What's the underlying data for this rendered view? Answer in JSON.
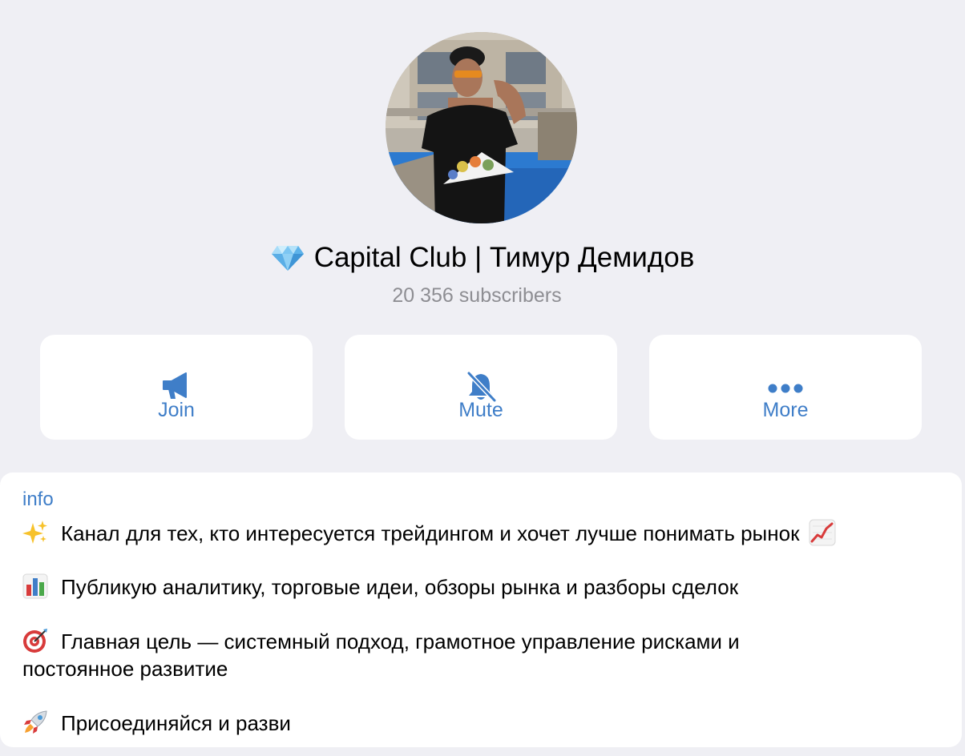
{
  "channel": {
    "title": "Capital Club | Тимур Демидов",
    "subscribers": "20 356 subscribers",
    "title_icon": "gem-icon"
  },
  "actions": [
    {
      "label": "Join",
      "icon": "megaphone-icon"
    },
    {
      "label": "Mute",
      "icon": "bell-slash-icon"
    },
    {
      "label": "More",
      "icon": "ellipsis-icon"
    }
  ],
  "info": {
    "label": "info",
    "lines": [
      {
        "emoji": "sparkles-icon",
        "text": "Канал для тех, кто интересуется трейдингом и хочет лучше понимать рынок",
        "trailing_emoji": "chart-increasing-icon"
      },
      {
        "emoji": "bar-chart-icon",
        "text": "Публикую аналитику, торговые идеи, обзоры рынка и разборы сделок"
      },
      {
        "emoji": "target-icon",
        "text": "Главная цель — системный подход, грамотное управление рисками и",
        "continuation": "постоянное развитие"
      },
      {
        "emoji": "rocket-icon",
        "text": "Присоединяйся и разви"
      }
    ]
  },
  "colors": {
    "background": "#efeff4",
    "accent": "#3f7ec8",
    "secondary_text": "#8e8e93",
    "card": "#ffffff"
  }
}
